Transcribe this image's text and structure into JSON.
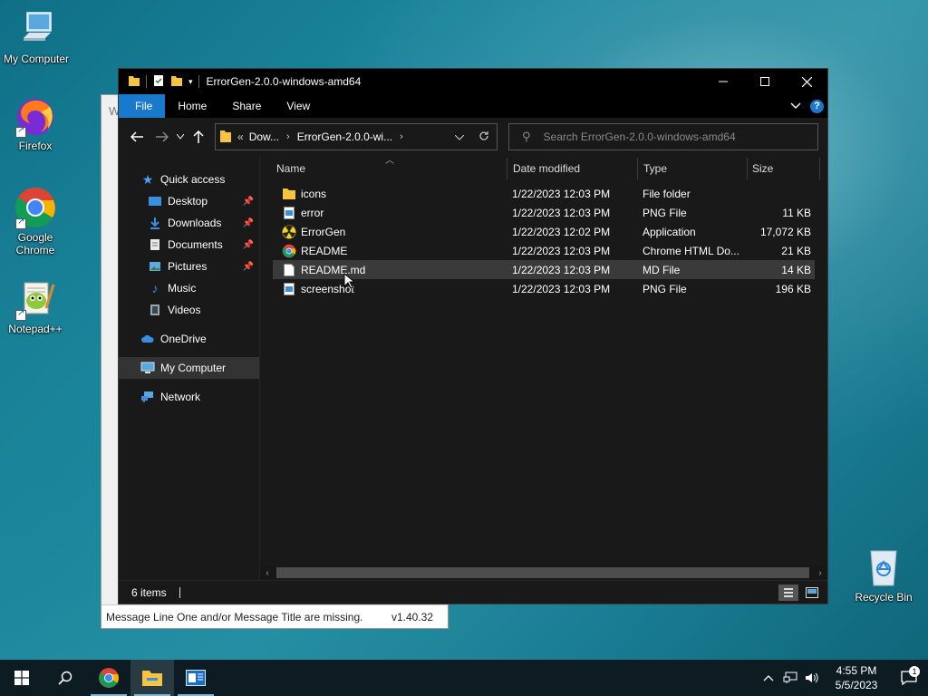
{
  "desktop": {
    "icons": [
      {
        "label": "My Computer",
        "icon": "computer-icon"
      },
      {
        "label": "Firefox",
        "icon": "firefox-icon"
      },
      {
        "label": "Google Chrome",
        "icon": "chrome-icon"
      },
      {
        "label": "Notepad++",
        "icon": "notepadpp-icon"
      },
      {
        "label": "Recycle Bin",
        "icon": "recycle-bin-icon"
      }
    ]
  },
  "bg_app": {
    "title_fragment": "W",
    "status_message": "Message Line One and/or Message Title are missing.",
    "version": "v1.40.32"
  },
  "explorer": {
    "title": "ErrorGen-2.0.0-windows-amd64",
    "ribbon_tabs": [
      "File",
      "Home",
      "Share",
      "View"
    ],
    "address": {
      "prefix": "«",
      "crumbs": [
        "Dow...",
        "ErrorGen-2.0.0-wi..."
      ]
    },
    "search_placeholder": "Search ErrorGen-2.0.0-windows-amd64",
    "nav": {
      "quick_access": "Quick access",
      "items": [
        {
          "label": "Desktop",
          "icon": "desktop-folder-icon",
          "pinned": true
        },
        {
          "label": "Downloads",
          "icon": "downloads-icon",
          "pinned": true
        },
        {
          "label": "Documents",
          "icon": "documents-icon",
          "pinned": true
        },
        {
          "label": "Pictures",
          "icon": "pictures-icon",
          "pinned": true
        },
        {
          "label": "Music",
          "icon": "music-icon",
          "pinned": false
        },
        {
          "label": "Videos",
          "icon": "videos-icon",
          "pinned": false
        }
      ],
      "onedrive": "OneDrive",
      "my_computer": "My Computer",
      "network": "Network"
    },
    "columns": {
      "name": "Name",
      "date": "Date modified",
      "type": "Type",
      "size": "Size"
    },
    "files": [
      {
        "name": "icons",
        "date": "1/22/2023 12:03 PM",
        "type": "File folder",
        "size": "",
        "icon": "folder-icon"
      },
      {
        "name": "error",
        "date": "1/22/2023 12:03 PM",
        "type": "PNG File",
        "size": "11 KB",
        "icon": "png-file-icon"
      },
      {
        "name": "ErrorGen",
        "date": "1/22/2023 12:02 PM",
        "type": "Application",
        "size": "17,072 KB",
        "icon": "radiation-app-icon"
      },
      {
        "name": "README",
        "date": "1/22/2023 12:03 PM",
        "type": "Chrome HTML Do...",
        "size": "21 KB",
        "icon": "chrome-html-icon"
      },
      {
        "name": "README.md",
        "date": "1/22/2023 12:03 PM",
        "type": "MD File",
        "size": "14 KB",
        "icon": "md-file-icon"
      },
      {
        "name": "screenshot",
        "date": "1/22/2023 12:03 PM",
        "type": "PNG File",
        "size": "196 KB",
        "icon": "png-file-icon"
      }
    ],
    "status": {
      "item_count": "6 items"
    }
  },
  "taskbar": {
    "apps": [
      "start-icon",
      "search-icon",
      "chrome-icon",
      "file-explorer-icon",
      "app-window-icon"
    ],
    "clock": {
      "time": "4:55 PM",
      "date": "5/5/2023"
    },
    "notification_count": "1"
  },
  "colors": {
    "explorer_bg": "#191919",
    "accent": "#1979ca",
    "taskbar": "#0d1b22",
    "folder": "#f5c542"
  }
}
